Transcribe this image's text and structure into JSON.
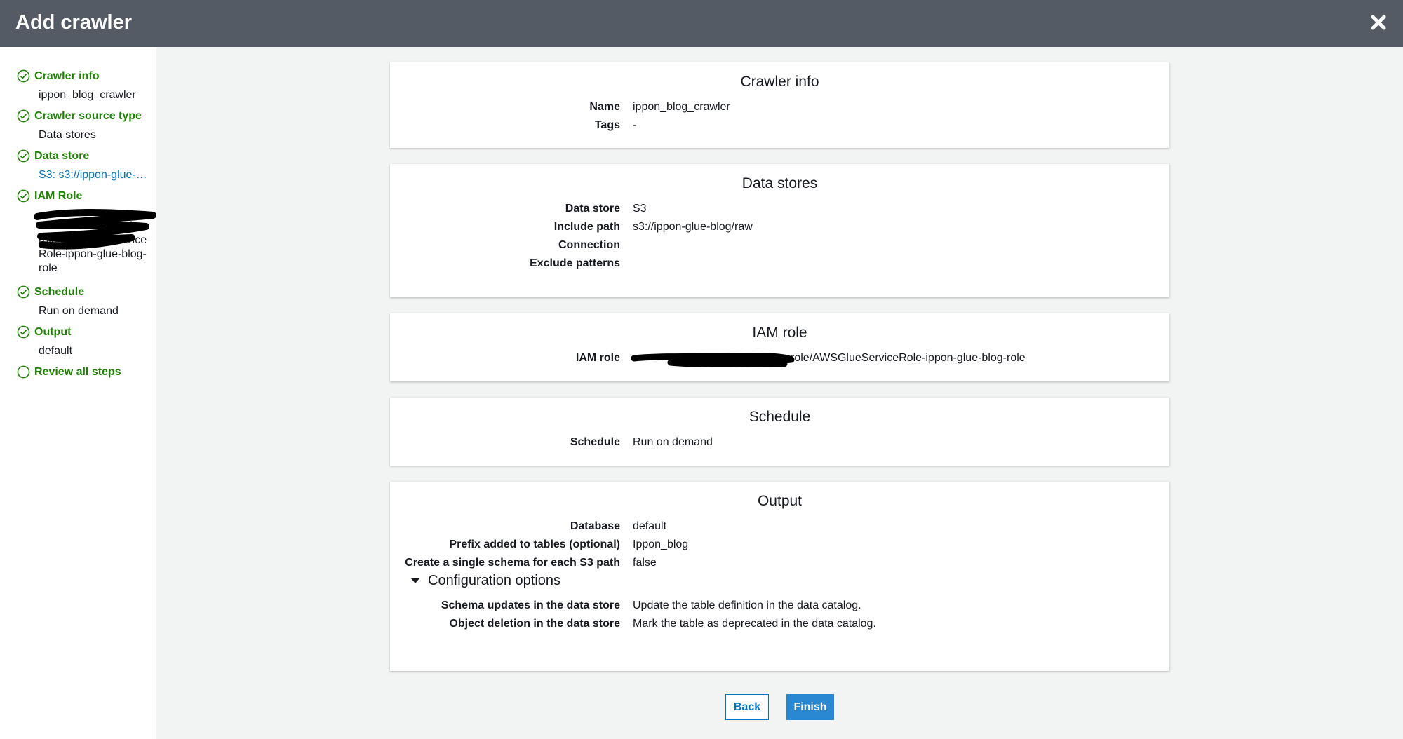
{
  "header": {
    "title": "Add crawler",
    "close_icon": "close-icon"
  },
  "sidebar": {
    "steps": [
      {
        "label": "Crawler info",
        "detail": "ippon_blog_crawler",
        "status": "complete"
      },
      {
        "label": "Crawler source type",
        "detail": "Data stores",
        "status": "complete"
      },
      {
        "label": "Data store",
        "detail": "S3: s3://ippon-glue-…",
        "status": "complete"
      },
      {
        "label": "IAM Role",
        "detail_lines": [
          "service-",
          "role/AWSGlueService",
          "Role-ippon-glue-blog-",
          "role"
        ],
        "status": "complete"
      },
      {
        "label": "Schedule",
        "detail": "Run on demand",
        "status": "complete"
      },
      {
        "label": "Output",
        "detail": "default",
        "status": "complete"
      },
      {
        "label": "Review all steps",
        "status": "current"
      }
    ]
  },
  "sections": {
    "crawler_info": {
      "title": "Crawler info",
      "rows": [
        {
          "key": "Name",
          "value": "ippon_blog_crawler"
        },
        {
          "key": "Tags",
          "value": "-"
        }
      ]
    },
    "data_stores": {
      "title": "Data stores",
      "rows": [
        {
          "key": "Data store",
          "value": "S3"
        },
        {
          "key": "Include path",
          "value": "s3://ippon-glue-blog/raw"
        },
        {
          "key": "Connection",
          "value": ""
        },
        {
          "key": "Exclude patterns",
          "value": ""
        }
      ]
    },
    "iam_role": {
      "title": "IAM role",
      "rows": [
        {
          "key": "IAM role",
          "value": "service-role/AWSGlueServiceRole-ippon-glue-blog-role"
        }
      ]
    },
    "schedule": {
      "title": "Schedule",
      "rows": [
        {
          "key": "Schedule",
          "value": "Run on demand"
        }
      ]
    },
    "output": {
      "title": "Output",
      "rows": [
        {
          "key": "Database",
          "value": "default"
        },
        {
          "key": "Prefix added to tables (optional)",
          "value": "Ippon_blog"
        },
        {
          "key": "Create a single schema for each S3 path",
          "value": "false"
        }
      ],
      "config_toggle": "Configuration options",
      "config_rows": [
        {
          "key": "Schema updates in the data store",
          "value": "Update the table definition in the data catalog."
        },
        {
          "key": "Object deletion in the data store",
          "value": "Mark the table as deprecated in the data catalog."
        }
      ]
    }
  },
  "footer": {
    "back_label": "Back",
    "finish_label": "Finish"
  },
  "colors": {
    "header_bg": "#545b64",
    "step_green": "#1d8102",
    "link_blue": "#0073bb",
    "primary_button": "#2a88d2"
  }
}
